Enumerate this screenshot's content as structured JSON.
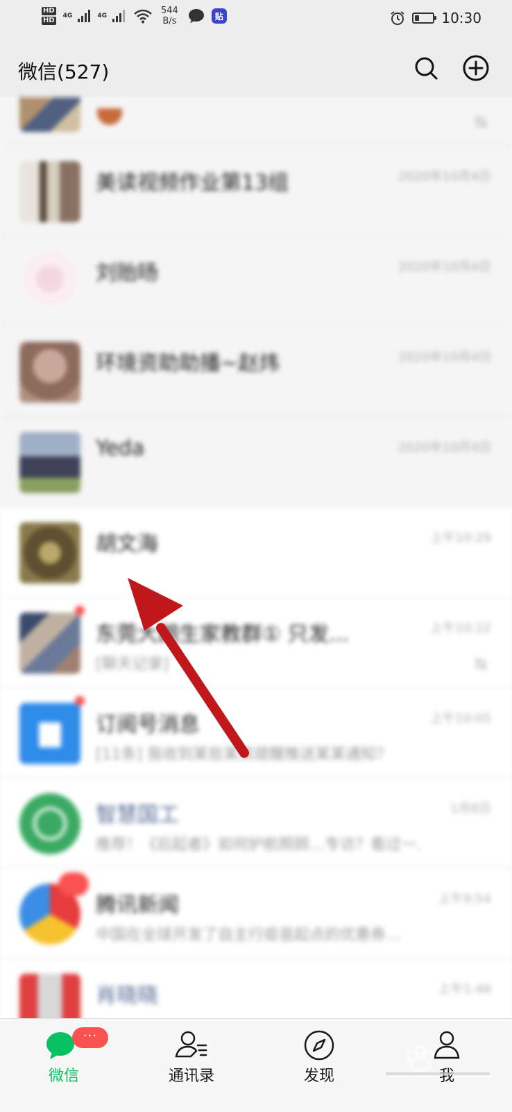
{
  "status_bar": {
    "hd1": "HD",
    "hd2": "HD",
    "net1": "4G",
    "net2": "4G",
    "speed_value": "544",
    "speed_unit": "B/s",
    "app_badge": "贴",
    "time": "10:30",
    "battery_level": 0.25
  },
  "header": {
    "title": "微信(527)",
    "search_icon": "search-icon",
    "add_icon": "plus-circle-icon"
  },
  "chats": [
    {
      "name": "",
      "preview": "",
      "time": "",
      "muted": true
    },
    {
      "name": "美读视频作业第13组",
      "preview": "",
      "time": "2020年10月4日"
    },
    {
      "name": "刘贻旸",
      "preview": "",
      "time": "2020年10月4日"
    },
    {
      "name": "环境资助助播~赵炜",
      "preview": "",
      "time": "2020年10月4日"
    },
    {
      "name": "Yeda",
      "preview": "",
      "time": "2020年10月4日"
    },
    {
      "name": "胡文海",
      "preview": "",
      "time": "上午10:29"
    },
    {
      "name": "东莞大朗生家教群① 只发...",
      "preview": "[聊天记录]",
      "time": "上午10:22",
      "muted": true
    },
    {
      "name": "订阅号消息",
      "preview": "[11条] 我收到某些某某提醒推送某某通知？",
      "time": "上午10:05"
    },
    {
      "name": "智慧国工",
      "preview": "推荐！《后起者》如何护航照顾…专访？看过一...",
      "time": "1月8日"
    },
    {
      "name": "腾讯新闻",
      "preview": "中国在全球开发了自主行疫苗起点的优惠券...",
      "time": "上午9:54"
    },
    {
      "name": "肖晓晓",
      "preview": "",
      "time": "上午1:48"
    }
  ],
  "bottom_nav": [
    {
      "label": "微信",
      "icon": "chat-bubble-icon",
      "active": true,
      "badge": "···"
    },
    {
      "label": "通讯录",
      "icon": "contacts-icon"
    },
    {
      "label": "发现",
      "icon": "compass-icon"
    },
    {
      "label": "我",
      "icon": "person-icon"
    }
  ],
  "colors": {
    "accent": "#07c160",
    "badge": "#fa5151",
    "annotation_arrow": "#c0171b"
  }
}
